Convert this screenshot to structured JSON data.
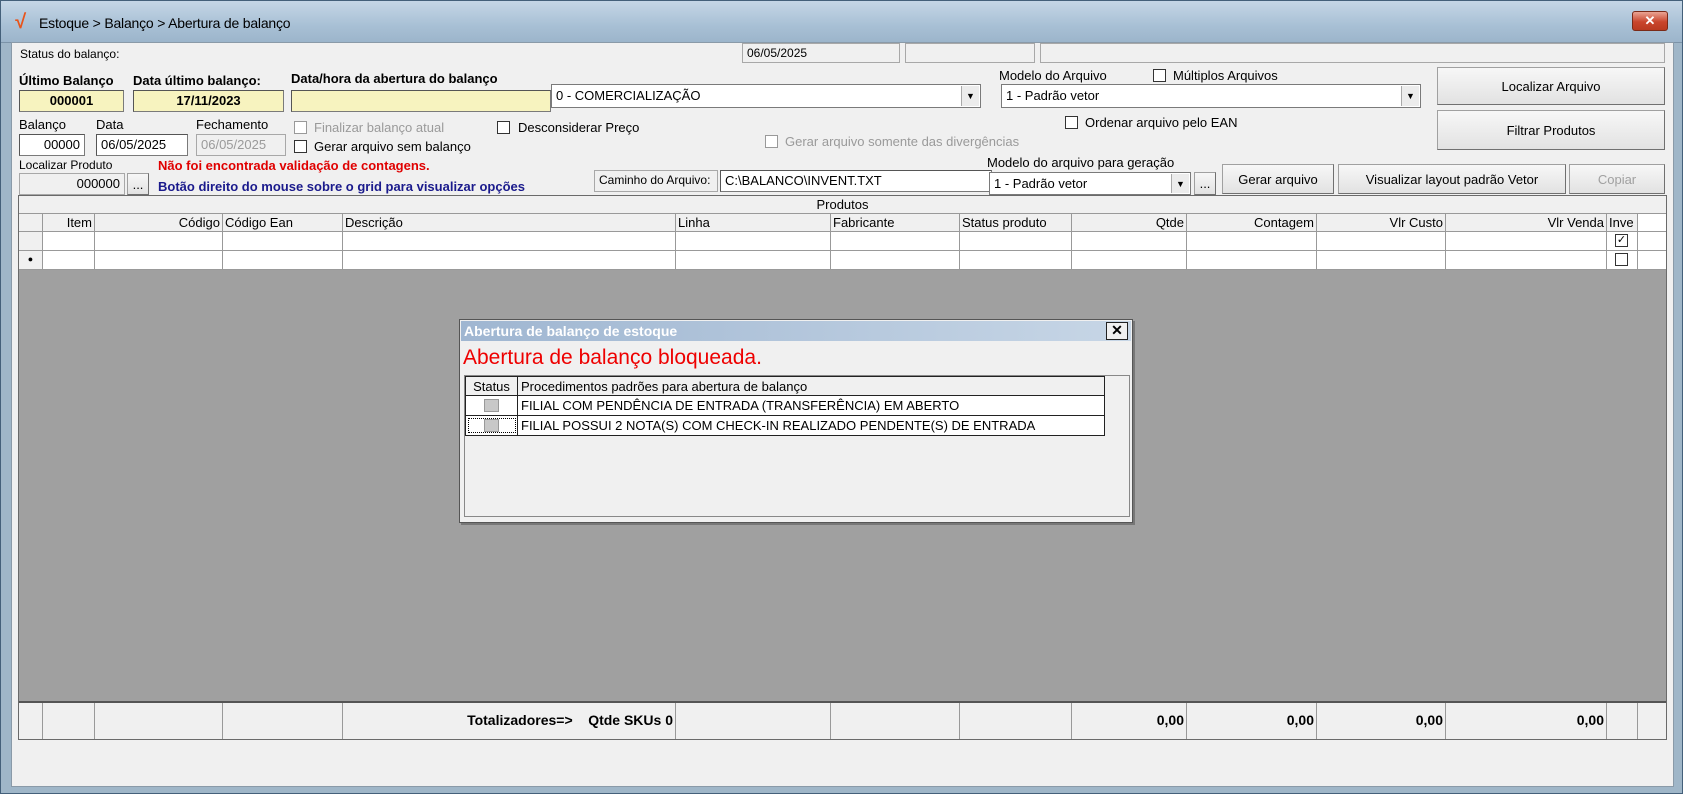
{
  "window": {
    "title": "Estoque > Balanço > Abertura de balanço",
    "close": "✕"
  },
  "status_bar": {
    "label": "Status do balanço:",
    "date": "06/05/2025"
  },
  "header": {
    "ultimo_label": "Último Balanço",
    "ultimo_value": "000001",
    "data_ultimo_label": "Data último balanço:",
    "data_ultimo_value": "17/11/2023",
    "abertura_label": "Data/hora da abertura do balanço",
    "abertura_value": "",
    "tipo_value": "0 - COMERCIALIZAÇÃO",
    "modelo_label": "Modelo do Arquivo",
    "modelo_value": "1 - Padrão vetor",
    "multiplos_label": "Múltiplos Arquivos",
    "localizar_arquivo": "Localizar Arquivo",
    "filtrar_produtos": "Filtrar Produtos"
  },
  "balanco": {
    "balanco_label": "Balanço",
    "balanco_value": "00000",
    "data_label": "Data",
    "data_value": "06/05/2025",
    "fechamento_label": "Fechamento",
    "fechamento_value": "06/05/2025",
    "finalizar_label": "Finalizar balanço atual",
    "gerar_sem_label": "Gerar arquivo sem balanço",
    "desconsiderar_label": "Desconsiderar Preço",
    "gerar_div_label": "Gerar arquivo somente das divergências",
    "ordenar_label": "Ordenar arquivo pelo EAN"
  },
  "produto": {
    "localizar_label": "Localizar Produto",
    "localizar_value": "000000",
    "browse": "...",
    "aviso_red": "Não foi encontrada validação de contagens.",
    "aviso_blue": "Botão direito do mouse sobre o grid para visualizar opções",
    "caminho_label": "Caminho do Arquivo:",
    "caminho_value": "C:\\BALANCO\\INVENT.TXT",
    "modelo_geracao_label": "Modelo do arquivo para geração",
    "modelo_geracao_value": "1 - Padrão vetor",
    "gerar_arquivo": "Gerar arquivo",
    "visualizar_layout": "Visualizar layout padrão Vetor",
    "copiar": "Copiar"
  },
  "grid": {
    "title": "Produtos",
    "columns": [
      "",
      "Item",
      "Código",
      "Código Ean",
      "Descrição",
      "Linha",
      "Fabricante",
      "Status produto",
      "Qtde",
      "Contagem",
      "Vlr Custo",
      "Vlr Venda",
      "Inve"
    ],
    "row_marker": "●",
    "totals_label": "Totalizadores=>",
    "skus_label": "Qtde SKUs 0",
    "tot_qtde": "0,00",
    "tot_contagem": "0,00",
    "tot_custo": "0,00",
    "tot_venda": "0,00"
  },
  "dialog": {
    "title": "Abertura de balanço de estoque",
    "close": "✕",
    "heading": "Abertura de balanço bloqueada.",
    "col_status": "Status",
    "col_proc": "Procedimentos padrões para abertura de balanço",
    "items": [
      "FILIAL COM PENDÊNCIA DE ENTRADA (TRANSFERÊNCIA) EM ABERTO",
      "FILIAL POSSUI 2 NOTA(S) COM CHECK-IN REALIZADO PENDENTE(S) DE ENTRADA"
    ]
  },
  "colors": {
    "accent_red": "#e00000",
    "accent_blue": "#1a1a8c",
    "highlight_yellow": "#f7f3bf"
  }
}
